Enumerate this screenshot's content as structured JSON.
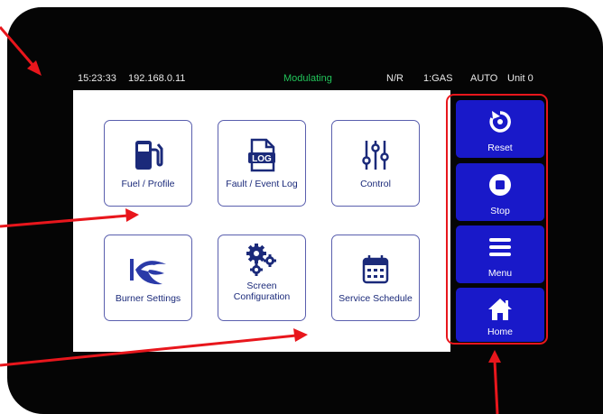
{
  "status_bar": {
    "time": "15:23:33",
    "ip_address": "192.168.0.11",
    "burner_state": "Modulating",
    "nr": "N/R",
    "fuel": "1:GAS",
    "mode": "AUTO",
    "unit": "Unit 0"
  },
  "tiles": [
    {
      "label": "Fuel / Profile",
      "icon": "fuel-pump-icon"
    },
    {
      "label": "Fault / Event Log",
      "icon": "log-document-icon"
    },
    {
      "label": "Control",
      "icon": "sliders-icon"
    },
    {
      "label": "Burner Settings",
      "icon": "burner-flame-icon"
    },
    {
      "label": "Screen Configuration",
      "icon": "gears-icon"
    },
    {
      "label": "Service Schedule",
      "icon": "calendar-icon"
    }
  ],
  "controls": [
    {
      "label": "Reset",
      "icon": "reset-icon"
    },
    {
      "label": "Stop",
      "icon": "stop-icon"
    },
    {
      "label": "Menu",
      "icon": "hamburger-icon"
    },
    {
      "label": "Home",
      "icon": "home-icon"
    }
  ],
  "colors": {
    "bezel": "#050505",
    "accent_button": "#1919c9",
    "tile_border": "#5a5fae",
    "tile_text": "#1b2a7a",
    "status_modulating": "#22c45a",
    "annotation_red": "#e8161c"
  }
}
